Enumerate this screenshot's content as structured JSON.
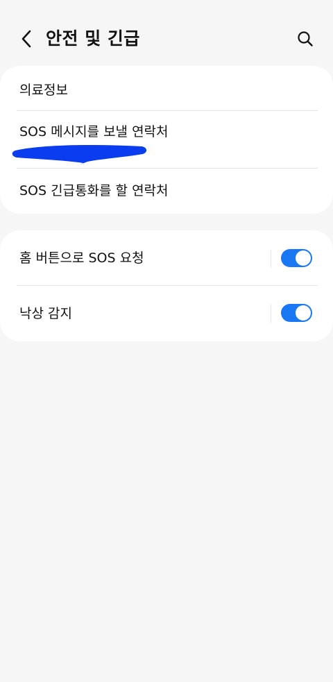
{
  "header": {
    "title": "안전 및 긴급",
    "back_icon": "chevron-left-icon",
    "search_icon": "search-icon"
  },
  "emergency_card": {
    "items": [
      {
        "label": "의료정보"
      },
      {
        "label": "SOS 메시지를 보낼 연락처"
      },
      {
        "label": "SOS 긴급통화를 할 연락처"
      }
    ]
  },
  "toggle_card": {
    "items": [
      {
        "label": "홈 버튼으로 SOS 요청",
        "enabled": true
      },
      {
        "label": "낙상 감지",
        "enabled": true
      }
    ]
  },
  "colors": {
    "accent": "#1977f3",
    "redaction": "#0a3cf0",
    "background": "#f6f6f6",
    "card": "#ffffff"
  }
}
